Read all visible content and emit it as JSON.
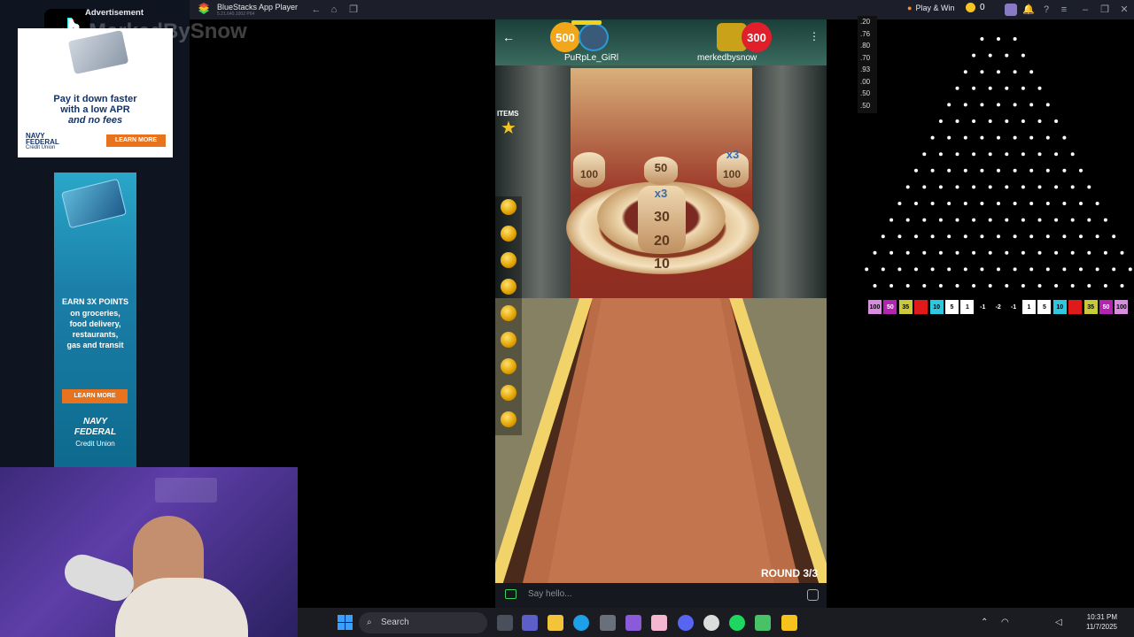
{
  "window": {
    "title": "BlueStacks App Player",
    "version": "5.21.640.1002 P64",
    "play_win_label": "Play & Win",
    "coin_count": "0"
  },
  "sidebar": {
    "ad_header": "Advertisement",
    "watermark": "MerkedBySnow",
    "ad1": {
      "line1": "Pay it down faster",
      "line2": "with a low APR",
      "line3": "and no fees",
      "brand_line1": "NAVY",
      "brand_line2": "FEDERAL",
      "brand_line3": "Credit Union",
      "cta": "LEARN MORE"
    },
    "ad2": {
      "line1": "EARN 3X POINTS",
      "line2": "on groceries,",
      "line3": "food delivery,",
      "line4": "restaurants,",
      "line5": "gas and transit",
      "cta": "LEARN MORE",
      "brand_line1": "NAVY",
      "brand_line2": "FEDERAL",
      "brand_line3": "Credit Union"
    }
  },
  "game": {
    "player1": {
      "name": "PuRpLe_GiRl",
      "score": "500"
    },
    "player2": {
      "name": "merkedbysnow",
      "score": "300"
    },
    "items_label": "ITEMS",
    "holes": {
      "left_100": "100",
      "center_50": "50",
      "right_100": "100",
      "multiplier_top": "x3",
      "multiplier_center": "x3",
      "ring_30": "30",
      "ring_20": "20",
      "ring_10": "10"
    },
    "round": "ROUND 3/3",
    "chat_placeholder": "Say hello..."
  },
  "odds": [
    ".20",
    ".76",
    ".80",
    ".70",
    ".93",
    ".00",
    ".50",
    ".50"
  ],
  "plinko": {
    "slots": [
      "100",
      "50",
      "35",
      "",
      "10",
      "5",
      "1",
      "-1",
      "-2",
      "-1",
      "1",
      "5",
      "10",
      "",
      "35",
      "50",
      "100"
    ],
    "slot_colors": [
      "#d98ce0",
      "#b324b3",
      "#c9c93a",
      "#e01a1a",
      "#2dc9e0",
      "#ffffff",
      "#ffffff",
      "#000000",
      "#000000",
      "#000000",
      "#ffffff",
      "#ffffff",
      "#2dc9e0",
      "#e01a1a",
      "#c9c93a",
      "#b324b3",
      "#d98ce0"
    ]
  },
  "taskbar": {
    "search_label": "Search",
    "time": "10:31 PM",
    "date": "11/7/2025"
  }
}
